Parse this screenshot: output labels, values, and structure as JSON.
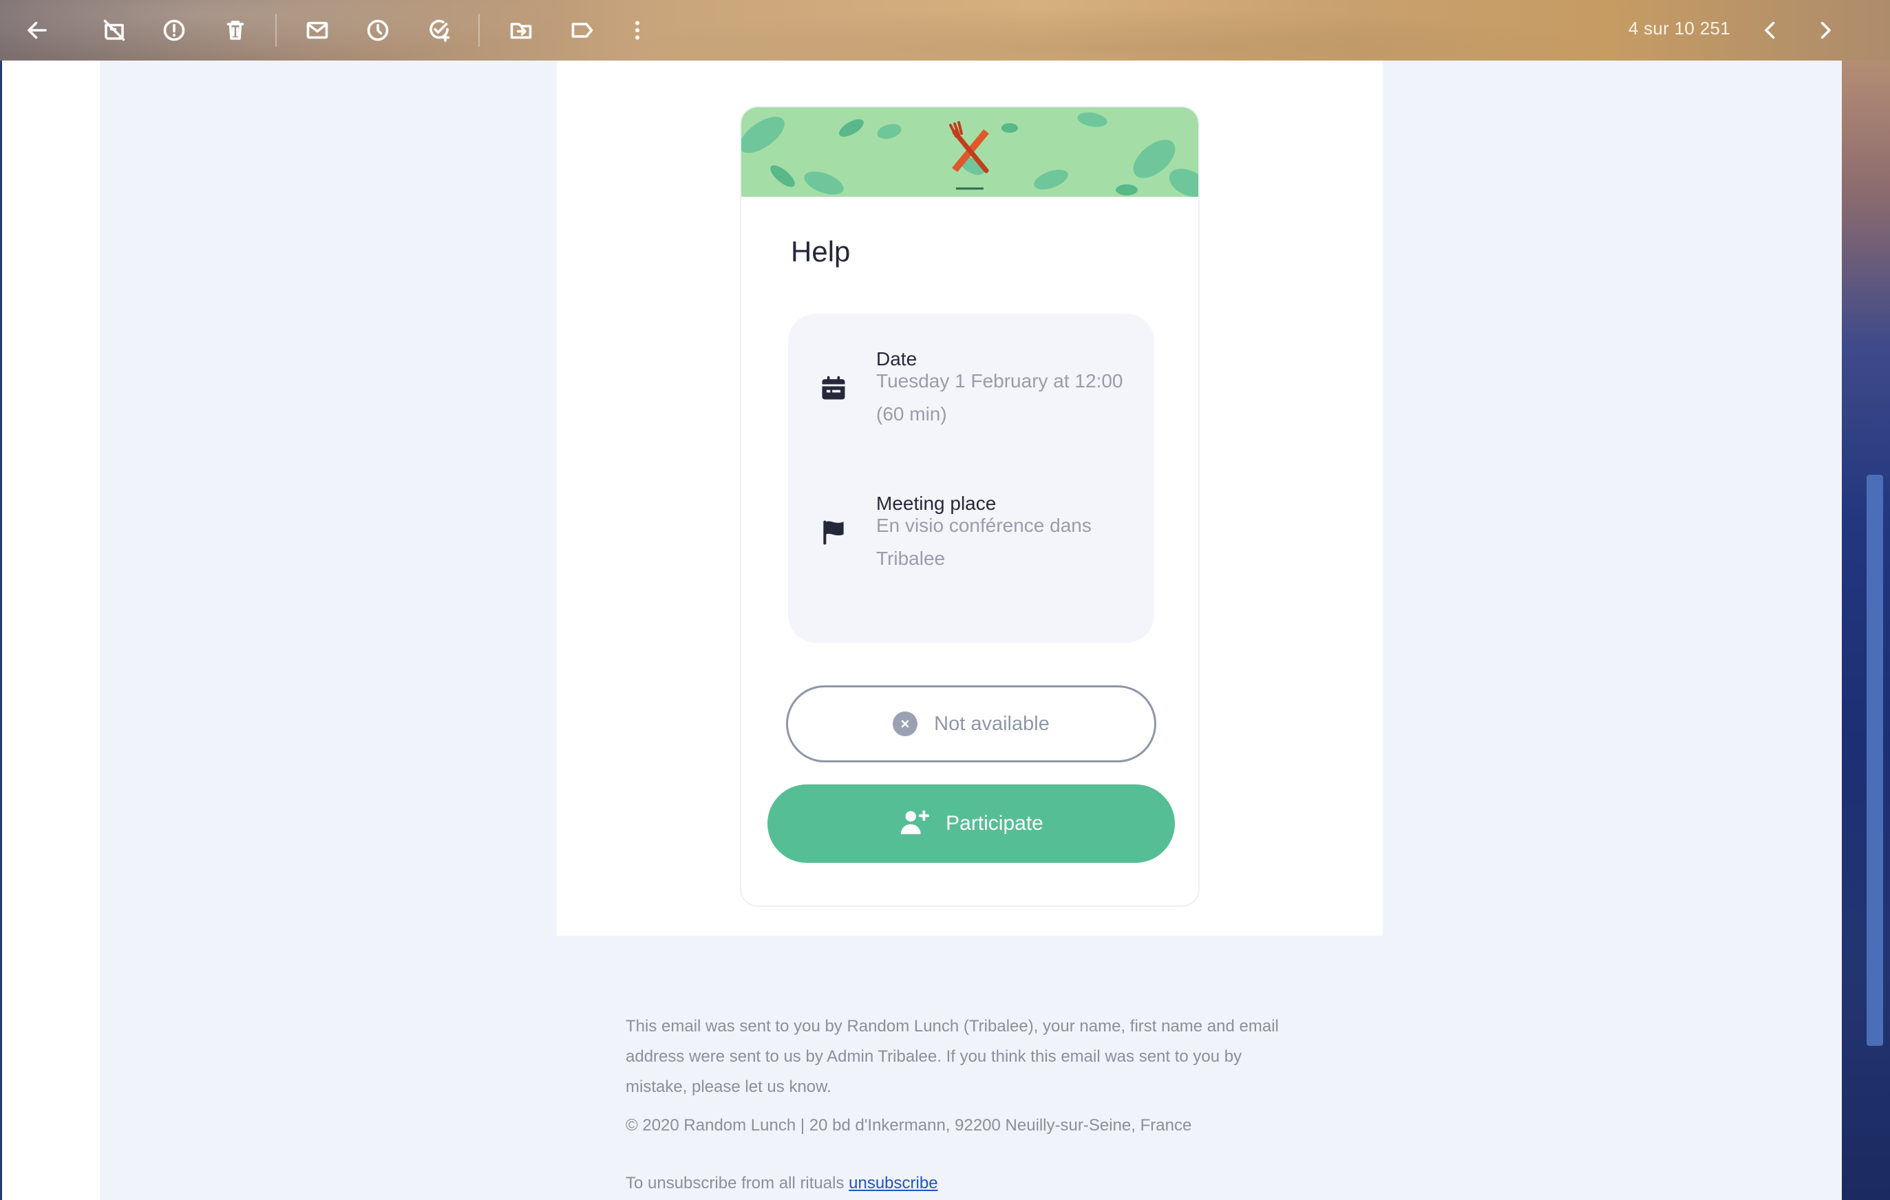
{
  "toolbar": {
    "icons": [
      "back-arrow-icon",
      "archive-off-icon",
      "report-spam-icon",
      "delete-icon",
      "mark-unread-icon",
      "snooze-icon",
      "add-task-icon",
      "move-to-icon",
      "label-icon",
      "more-vertical-icon"
    ],
    "pager_text": "4 sur 10 251",
    "colors": {
      "icon": "#ffffff"
    }
  },
  "email": {
    "card": {
      "title": "Help",
      "date_label": "Date",
      "date_value": "Tuesday 1 February at 12:00 (60 min)",
      "place_label": "Meeting place",
      "place_value": "En visio conférence dans Tribalee",
      "not_available_label": "Not available",
      "participate_label": "Participate",
      "colors": {
        "banner": "#a4dea6",
        "participate": "#56be95",
        "not_available_border": "#8f96a8"
      }
    },
    "footer": {
      "notice": "This email was sent to you by Random Lunch (Tribalee), your name, first name and email address were sent to us by Admin Tribalee. If you think this email was sent to you by mistake, please let us know.",
      "copyright": "© 2020 Random Lunch | 20 bd d'Inkermann, 92200 Neuilly-sur-Seine, France",
      "unsubscribe_prefix": "To unsubscribe from all rituals",
      "unsubscribe_link": "unsubscribe"
    }
  }
}
